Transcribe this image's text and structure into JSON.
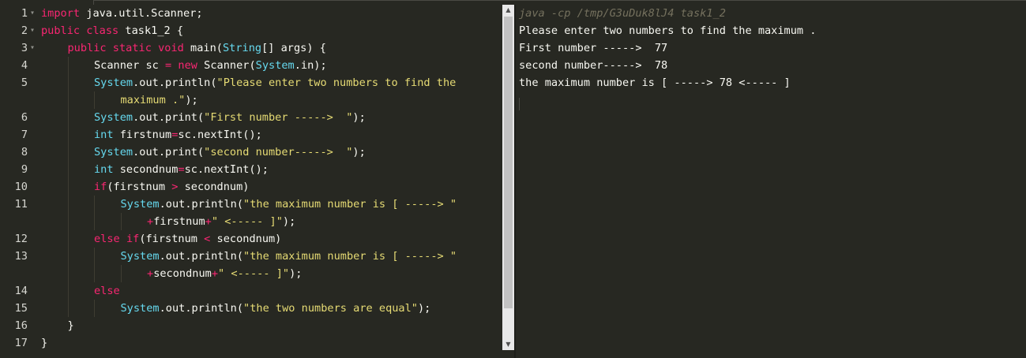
{
  "editor": {
    "lines": [
      {
        "num": "1",
        "fold": true,
        "indent": 0,
        "tokens": [
          {
            "c": "kw",
            "t": "import"
          },
          {
            "c": "pl",
            "t": " java.util.Scanner;"
          }
        ]
      },
      {
        "num": "2",
        "fold": true,
        "indent": 0,
        "tokens": [
          {
            "c": "kw",
            "t": "public"
          },
          {
            "c": "pl",
            "t": " "
          },
          {
            "c": "kw",
            "t": "class"
          },
          {
            "c": "pl",
            "t": " task1_2 {"
          }
        ]
      },
      {
        "num": "3",
        "fold": true,
        "indent": 1,
        "tokens": [
          {
            "c": "kw",
            "t": "public"
          },
          {
            "c": "pl",
            "t": " "
          },
          {
            "c": "kw",
            "t": "static"
          },
          {
            "c": "pl",
            "t": " "
          },
          {
            "c": "kw",
            "t": "void"
          },
          {
            "c": "pl",
            "t": " main("
          },
          {
            "c": "ty",
            "t": "String"
          },
          {
            "c": "pl",
            "t": "[] args) {"
          }
        ]
      },
      {
        "num": "4",
        "fold": false,
        "indent": 2,
        "tokens": [
          {
            "c": "pl",
            "t": "Scanner sc "
          },
          {
            "c": "op",
            "t": "="
          },
          {
            "c": "pl",
            "t": " "
          },
          {
            "c": "kw",
            "t": "new"
          },
          {
            "c": "pl",
            "t": " Scanner("
          },
          {
            "c": "ty",
            "t": "System"
          },
          {
            "c": "pl",
            "t": ".in);"
          }
        ]
      },
      {
        "num": "5",
        "fold": false,
        "indent": 2,
        "tokens": [
          {
            "c": "ty",
            "t": "System"
          },
          {
            "c": "pl",
            "t": ".out.println("
          },
          {
            "c": "st",
            "t": "\"Please enter two numbers to find the"
          }
        ]
      },
      {
        "num": "",
        "fold": false,
        "indent": 3,
        "tokens": [
          {
            "c": "st",
            "t": "maximum .\""
          },
          {
            "c": "pl",
            "t": ");"
          }
        ]
      },
      {
        "num": "6",
        "fold": false,
        "indent": 2,
        "tokens": [
          {
            "c": "ty",
            "t": "System"
          },
          {
            "c": "pl",
            "t": ".out.print("
          },
          {
            "c": "st",
            "t": "\"First number ----->  \""
          },
          {
            "c": "pl",
            "t": ");"
          }
        ]
      },
      {
        "num": "7",
        "fold": false,
        "indent": 2,
        "tokens": [
          {
            "c": "ty",
            "t": "int"
          },
          {
            "c": "pl",
            "t": " firstnum"
          },
          {
            "c": "op",
            "t": "="
          },
          {
            "c": "pl",
            "t": "sc.nextInt();"
          }
        ]
      },
      {
        "num": "8",
        "fold": false,
        "indent": 2,
        "tokens": [
          {
            "c": "ty",
            "t": "System"
          },
          {
            "c": "pl",
            "t": ".out.print("
          },
          {
            "c": "st",
            "t": "\"second number----->  \""
          },
          {
            "c": "pl",
            "t": ");"
          }
        ]
      },
      {
        "num": "9",
        "fold": false,
        "indent": 2,
        "tokens": [
          {
            "c": "ty",
            "t": "int"
          },
          {
            "c": "pl",
            "t": " secondnum"
          },
          {
            "c": "op",
            "t": "="
          },
          {
            "c": "pl",
            "t": "sc.nextInt();"
          }
        ]
      },
      {
        "num": "10",
        "fold": false,
        "indent": 2,
        "tokens": [
          {
            "c": "kw",
            "t": "if"
          },
          {
            "c": "pl",
            "t": "(firstnum "
          },
          {
            "c": "op",
            "t": ">"
          },
          {
            "c": "pl",
            "t": " secondnum)"
          }
        ]
      },
      {
        "num": "11",
        "fold": false,
        "indent": 3,
        "tokens": [
          {
            "c": "ty",
            "t": "System"
          },
          {
            "c": "pl",
            "t": ".out.println("
          },
          {
            "c": "st",
            "t": "\"the maximum number is [ -----> \""
          }
        ]
      },
      {
        "num": "",
        "fold": false,
        "indent": 4,
        "tokens": [
          {
            "c": "op",
            "t": "+"
          },
          {
            "c": "pl",
            "t": "firstnum"
          },
          {
            "c": "op",
            "t": "+"
          },
          {
            "c": "st",
            "t": "\" <----- ]\""
          },
          {
            "c": "pl",
            "t": ");"
          }
        ]
      },
      {
        "num": "12",
        "fold": false,
        "indent": 2,
        "tokens": [
          {
            "c": "kw",
            "t": "else"
          },
          {
            "c": "pl",
            "t": " "
          },
          {
            "c": "kw",
            "t": "if"
          },
          {
            "c": "pl",
            "t": "(firstnum "
          },
          {
            "c": "op",
            "t": "<"
          },
          {
            "c": "pl",
            "t": " secondnum)"
          }
        ]
      },
      {
        "num": "13",
        "fold": false,
        "indent": 3,
        "tokens": [
          {
            "c": "ty",
            "t": "System"
          },
          {
            "c": "pl",
            "t": ".out.println("
          },
          {
            "c": "st",
            "t": "\"the maximum number is [ -----> \""
          }
        ]
      },
      {
        "num": "",
        "fold": false,
        "indent": 4,
        "tokens": [
          {
            "c": "op",
            "t": "+"
          },
          {
            "c": "pl",
            "t": "secondnum"
          },
          {
            "c": "op",
            "t": "+"
          },
          {
            "c": "st",
            "t": "\" <----- ]\""
          },
          {
            "c": "pl",
            "t": ");"
          }
        ]
      },
      {
        "num": "14",
        "fold": false,
        "indent": 2,
        "tokens": [
          {
            "c": "kw",
            "t": "else"
          }
        ]
      },
      {
        "num": "15",
        "fold": false,
        "indent": 3,
        "tokens": [
          {
            "c": "ty",
            "t": "System"
          },
          {
            "c": "pl",
            "t": ".out.println("
          },
          {
            "c": "st",
            "t": "\"the two numbers are equal\""
          },
          {
            "c": "pl",
            "t": ");"
          }
        ]
      },
      {
        "num": "16",
        "fold": false,
        "indent": 1,
        "tokens": [
          {
            "c": "pl",
            "t": "}"
          }
        ]
      },
      {
        "num": "17",
        "fold": false,
        "indent": 0,
        "tokens": [
          {
            "c": "pl",
            "t": "}"
          }
        ]
      }
    ],
    "fold_glyph": "▾",
    "scroll_up_glyph": "▲",
    "scroll_down_glyph": "▼"
  },
  "console": {
    "command": "java -cp /tmp/G3uDuk8lJ4 task1_2",
    "output": [
      "Please enter two numbers to find the maximum .",
      "First number ----->  77",
      "second number----->  78",
      "the maximum number is [ -----> 78 <----- ]"
    ]
  },
  "colors": {
    "background": "#272822",
    "keyword": "#f92672",
    "type": "#66d9ef",
    "string": "#e6db74",
    "text": "#f8f8f2",
    "comment": "#75715e"
  }
}
